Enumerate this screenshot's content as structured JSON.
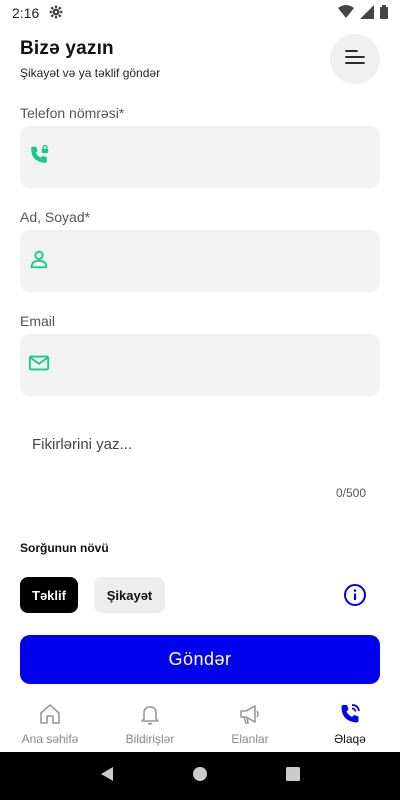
{
  "status": {
    "time": "2:16"
  },
  "header": {
    "title": "Bizə yazın",
    "subtitle": "Şikayət və ya təklif göndər"
  },
  "form": {
    "phone": {
      "label": "Telefon nömrəsi*",
      "value": "",
      "placeholder": ""
    },
    "name": {
      "label": "Ad, Soyad*",
      "value": "",
      "placeholder": ""
    },
    "email": {
      "label": "Email",
      "value": "",
      "placeholder": ""
    },
    "message": {
      "placeholder": "Fikirlərini yaz...",
      "counter": "0/500"
    }
  },
  "request_type": {
    "label": "Sorğunun növü",
    "options": [
      {
        "label": "Təklif",
        "selected": true
      },
      {
        "label": "Şikayət",
        "selected": false
      }
    ]
  },
  "submit_label": "Göndər",
  "tabs": [
    {
      "label": "Ana səhifə",
      "icon": "home-icon",
      "active": false
    },
    {
      "label": "Bildirişlər",
      "icon": "bell-icon",
      "active": false
    },
    {
      "label": "Elanlar",
      "icon": "megaphone-icon",
      "active": false
    },
    {
      "label": "Əlaqə",
      "icon": "phone-call-icon",
      "active": true
    }
  ],
  "colors": {
    "accent": "#0000ee",
    "icon_green": "#14c98a",
    "field_bg": "#f2f2f2",
    "chip_active": "#000000"
  }
}
